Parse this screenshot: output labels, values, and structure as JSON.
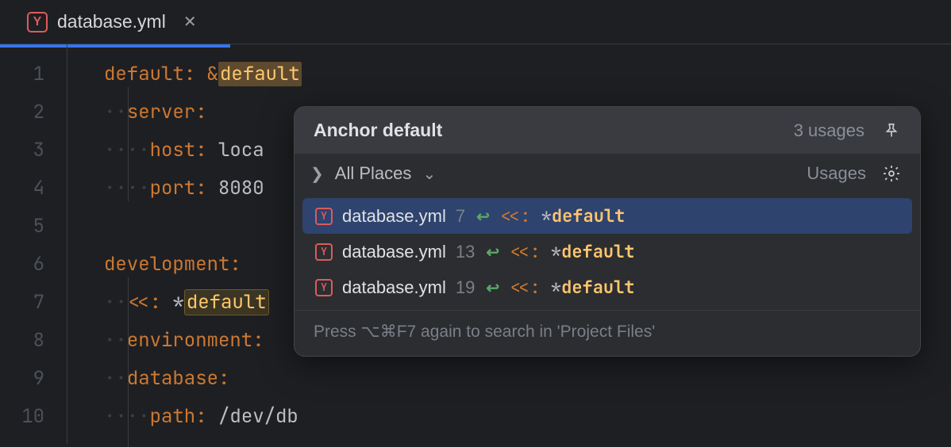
{
  "tab": {
    "filename": "database.yml"
  },
  "editor": {
    "lines": [
      {
        "n": 1
      },
      {
        "n": 2
      },
      {
        "n": 3
      },
      {
        "n": 4
      },
      {
        "n": 5
      },
      {
        "n": 6
      },
      {
        "n": 7
      },
      {
        "n": 8
      },
      {
        "n": 9
      },
      {
        "n": 10
      }
    ],
    "tokens": {
      "l1_key": "default",
      "l1_anchor": "default",
      "l2_key": "server",
      "l3_key": "host",
      "l3_val": "loca",
      "l4_key": "port",
      "l4_val": "8080",
      "l6_key": "development",
      "l7_op": "<<",
      "l7_ref": "default",
      "l8_key": "environment",
      "l9_key": "database",
      "l10_key": "path",
      "l10_val": "/dev/db"
    }
  },
  "popup": {
    "title": "Anchor default",
    "usage_count": "3 usages",
    "scope": "All Places",
    "scope_right": "Usages",
    "results": [
      {
        "file": "database.yml",
        "line": "7",
        "key": "<<",
        "ref": "default"
      },
      {
        "file": "database.yml",
        "line": "13",
        "key": "<<",
        "ref": "default"
      },
      {
        "file": "database.yml",
        "line": "19",
        "key": "<<",
        "ref": "default"
      }
    ],
    "footer": "Press ⌥⌘F7 again to search in 'Project Files'"
  }
}
